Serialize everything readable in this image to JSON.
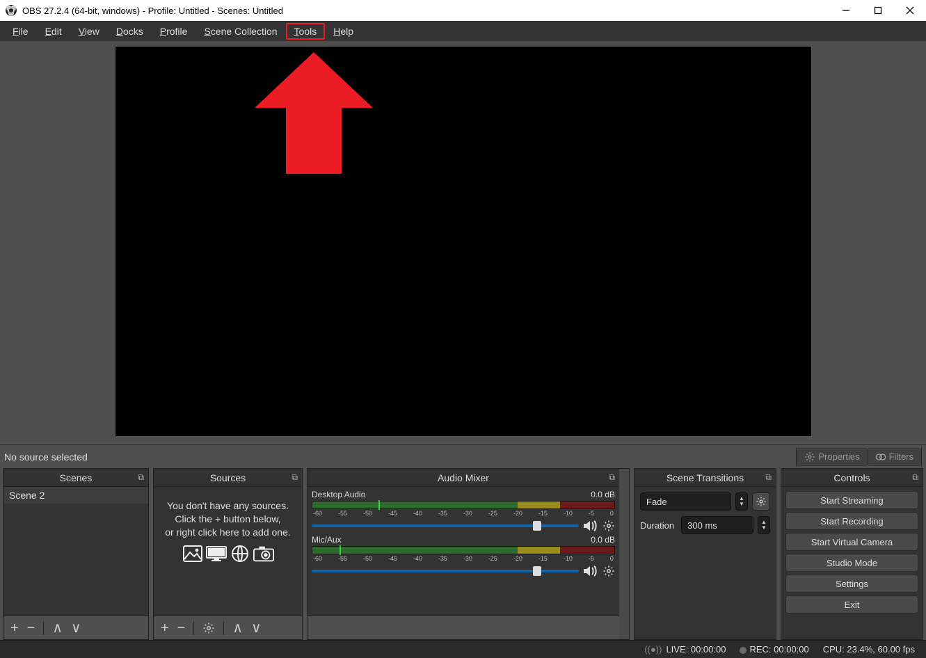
{
  "titlebar": {
    "title": "OBS 27.2.4 (64-bit, windows) - Profile: Untitled - Scenes: Untitled"
  },
  "menu": {
    "file": "File",
    "edit": "Edit",
    "view": "View",
    "docks": "Docks",
    "profile": "Profile",
    "scene_collection": "Scene Collection",
    "tools": "Tools",
    "help": "Help"
  },
  "srcinfo": {
    "none": "No source selected",
    "properties": "Properties",
    "filters": "Filters"
  },
  "docks": {
    "scenes": {
      "title": "Scenes",
      "items": [
        "Scene 2"
      ]
    },
    "sources": {
      "title": "Sources",
      "empty_line1": "You don't have any sources.",
      "empty_line2": "Click the + button below,",
      "empty_line3": "or right click here to add one."
    },
    "mixer": {
      "title": "Audio Mixer",
      "channels": [
        {
          "name": "Desktop Audio",
          "db": "0.0 dB"
        },
        {
          "name": "Mic/Aux",
          "db": "0.0 dB"
        }
      ],
      "scale": [
        "-60",
        "-55",
        "-50",
        "-45",
        "-40",
        "-35",
        "-30",
        "-25",
        "-20",
        "-15",
        "-10",
        "-5",
        "0"
      ]
    },
    "transitions": {
      "title": "Scene Transitions",
      "selected": "Fade",
      "duration_label": "Duration",
      "duration_value": "300 ms"
    },
    "controls": {
      "title": "Controls",
      "buttons": [
        "Start Streaming",
        "Start Recording",
        "Start Virtual Camera",
        "Studio Mode",
        "Settings",
        "Exit"
      ]
    }
  },
  "status": {
    "live": "LIVE: 00:00:00",
    "rec": "REC: 00:00:00",
    "cpu": "CPU: 23.4%, 60.00 fps"
  }
}
